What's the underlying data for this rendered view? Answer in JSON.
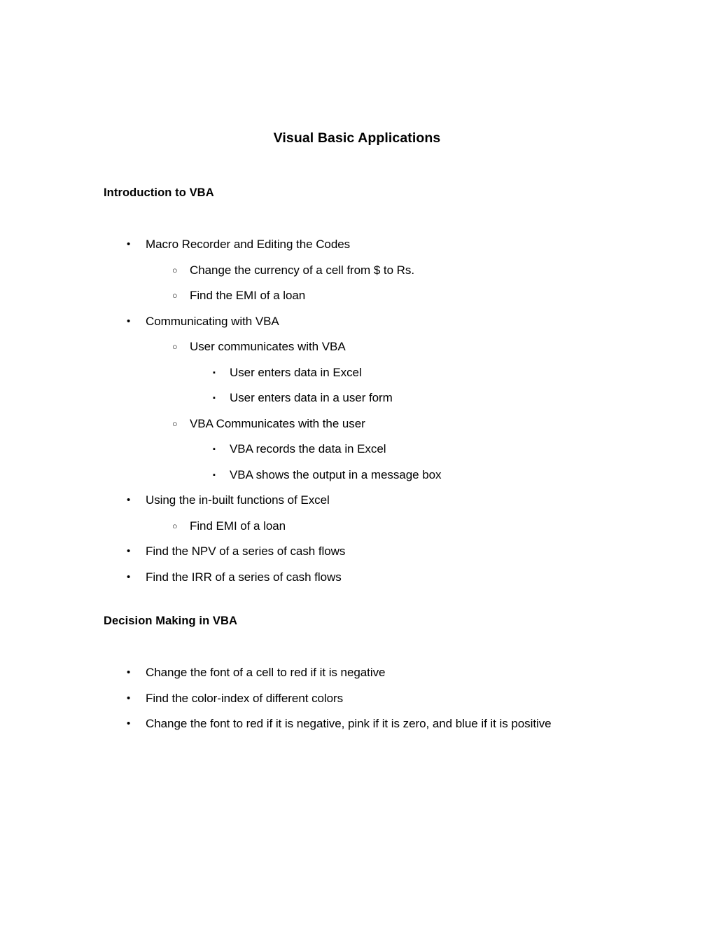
{
  "document": {
    "title": "Visual Basic Applications",
    "sections": [
      {
        "heading": "Introduction to VBA",
        "items": [
          {
            "level": 1,
            "marker": "bullet-disc",
            "glyph": "•",
            "text": "Macro Recorder and Editing the Codes"
          },
          {
            "level": 2,
            "marker": "bullet-circle",
            "glyph": "○",
            "text": "Change the currency of a cell from $ to Rs."
          },
          {
            "level": 2,
            "marker": "bullet-circle",
            "glyph": "○",
            "text": "Find the EMI of a loan"
          },
          {
            "level": 1,
            "marker": "bullet-disc",
            "glyph": "•",
            "text": "Communicating with VBA"
          },
          {
            "level": 2,
            "marker": "bullet-circle",
            "glyph": "○",
            "text": "User communicates with VBA"
          },
          {
            "level": 3,
            "marker": "bullet-square",
            "glyph": "▪",
            "text": "User enters data in Excel"
          },
          {
            "level": 3,
            "marker": "bullet-square",
            "glyph": "▪",
            "text": "User enters data in a user form"
          },
          {
            "level": 2,
            "marker": "bullet-circle",
            "glyph": "○",
            "text": "VBA Communicates with the user"
          },
          {
            "level": 3,
            "marker": "bullet-square",
            "glyph": "▪",
            "text": "VBA records the data in Excel"
          },
          {
            "level": 3,
            "marker": "bullet-square",
            "glyph": "▪",
            "text": "VBA shows the output in a message box"
          },
          {
            "level": 1,
            "marker": "bullet-disc",
            "glyph": "•",
            "text": "Using the in-built functions of Excel"
          },
          {
            "level": 2,
            "marker": "bullet-circle",
            "glyph": "○",
            "text": "Find EMI of a loan"
          },
          {
            "level": 1,
            "marker": "bullet-disc",
            "glyph": "•",
            "text": "Find the NPV of a series of cash flows"
          },
          {
            "level": 1,
            "marker": "bullet-disc",
            "glyph": "•",
            "text": "Find the IRR of a series of cash flows"
          }
        ]
      },
      {
        "heading": "Decision Making in VBA",
        "items": [
          {
            "level": 1,
            "marker": "bullet-disc",
            "glyph": "•",
            "text": "Change the font of a cell to red if it is negative"
          },
          {
            "level": 1,
            "marker": "bullet-disc",
            "glyph": "•",
            "text": "Find the color-index of different colors"
          },
          {
            "level": 1,
            "marker": "bullet-disc",
            "glyph": "•",
            "text": "Change the font to red if it is negative, pink if it is zero, and blue if it is positive"
          }
        ]
      }
    ],
    "colors": {
      "text": "#000000",
      "page_background": "#ffffff"
    }
  }
}
